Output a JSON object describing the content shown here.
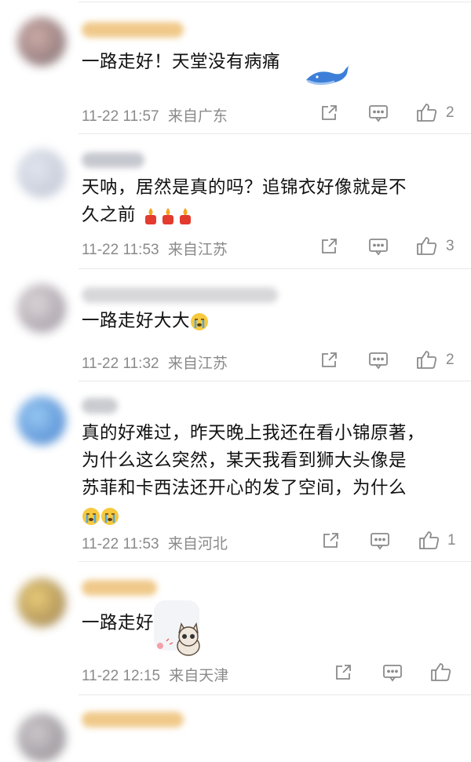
{
  "comments": [
    {
      "text": "一路走好！天堂没有病痛",
      "time": "11-22 11:57",
      "location": "来自广东",
      "likes": "2"
    },
    {
      "text_line1": "天呐，居然是真的吗？追锦衣好像就是不",
      "text_line2": "久之前",
      "time": "11-22 11:53",
      "location": "来自江苏",
      "likes": "3"
    },
    {
      "text": "一路走好大大",
      "time": "11-22 11:32",
      "location": "来自江苏",
      "likes": "2"
    },
    {
      "text_line1": "真的好难过，昨天晚上我还在看小锦原著，",
      "text_line2": "为什么这么突然，某天我看到狮大头像是",
      "text_line3": "苏菲和卡西法还开心的发了空间，为什么",
      "time": "11-22 11:53",
      "location": "来自河北",
      "likes": "1"
    },
    {
      "text": "一路走好",
      "time": "11-22 12:15",
      "location": "来自天津",
      "likes": ""
    }
  ],
  "icons": {
    "share": "share-icon",
    "reply": "comment-icon",
    "like": "thumbs-up-icon",
    "crying": "crying-face-emoji",
    "candle": "candle-emoji"
  },
  "colors": {
    "text": "#111111",
    "meta": "#8a8a8a",
    "divider": "#e9e9e9"
  }
}
